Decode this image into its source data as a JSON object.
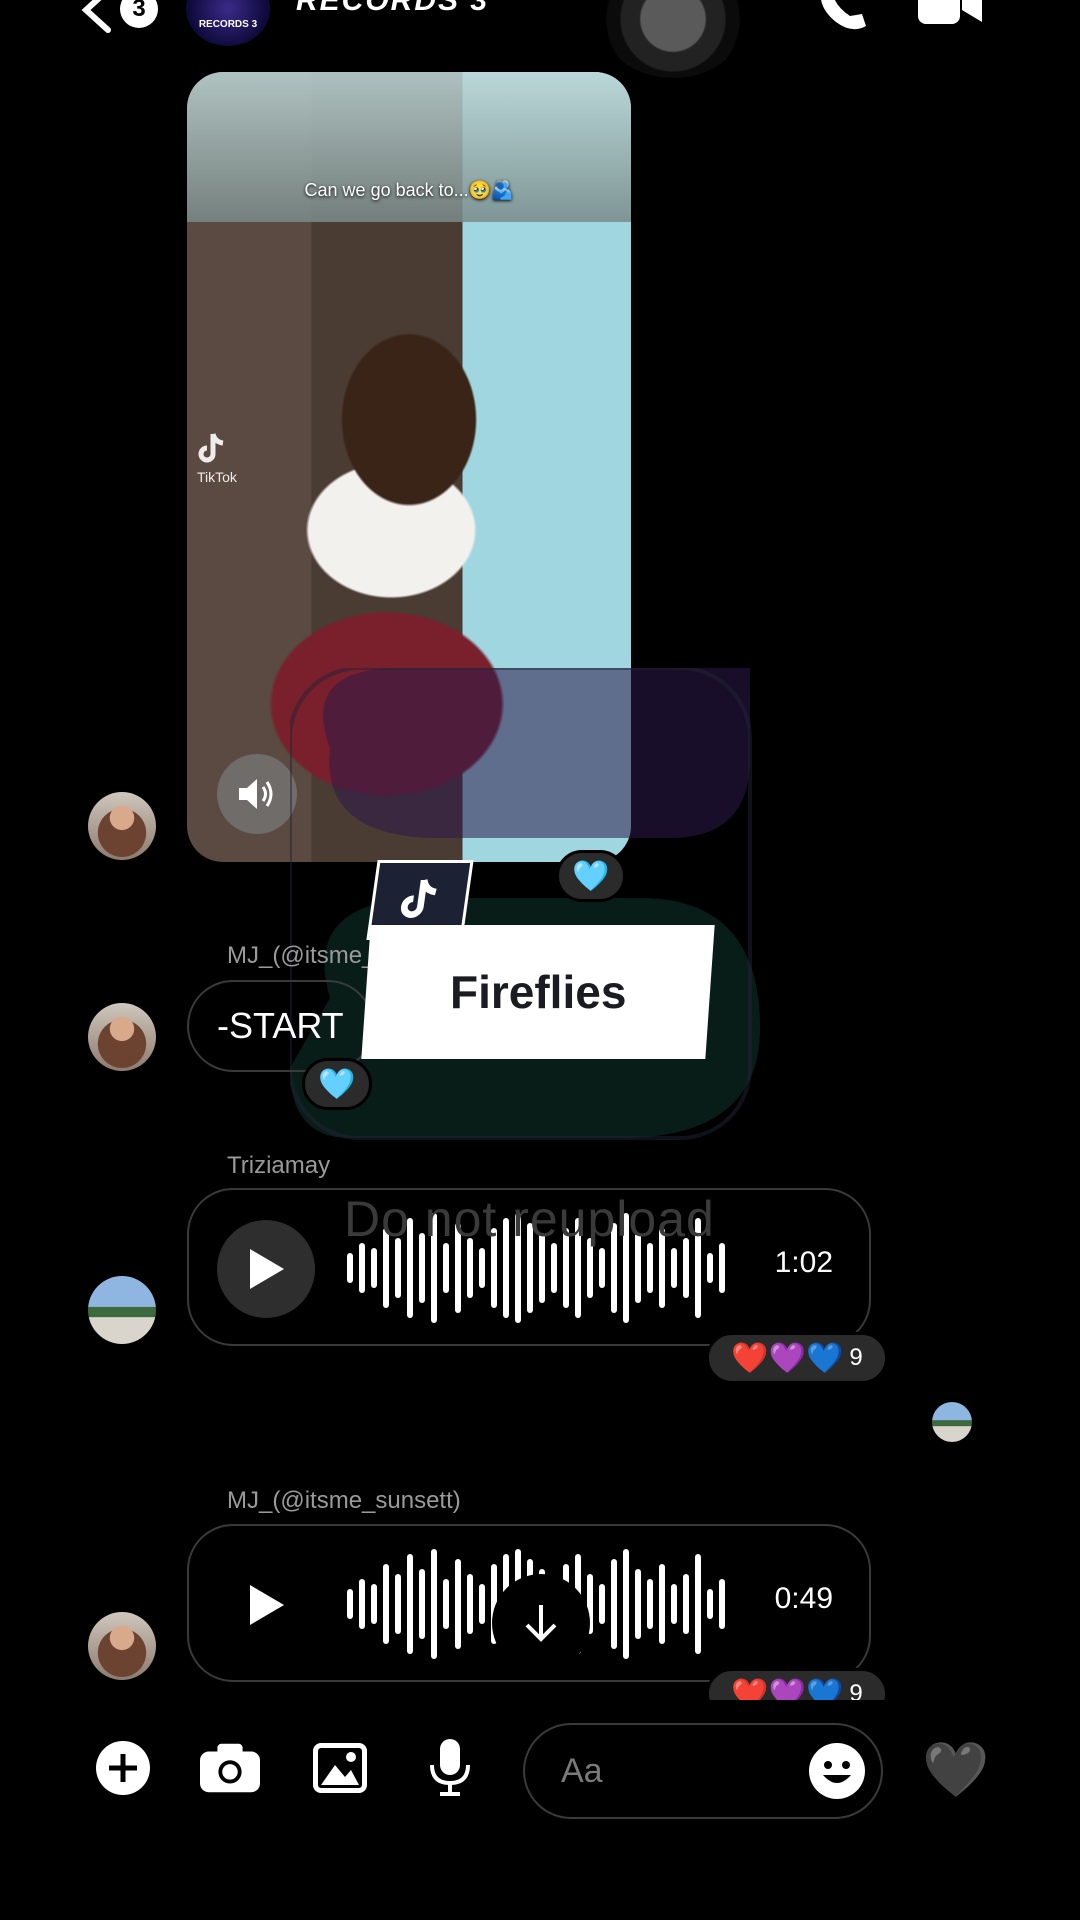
{
  "header": {
    "back_count": "3",
    "group_avatar_text": "RECORDS 3",
    "title": "RECORDS 3"
  },
  "video": {
    "caption": "Can we go back to...🥹🫂",
    "tiktok_mark": "TikTok",
    "reaction": "🩵"
  },
  "overlay": {
    "song_title": "Fireflies",
    "watermark": "Do not reupload"
  },
  "messages": [
    {
      "sender": "MJ_(@itsme_",
      "text": "-START",
      "reaction": "🩵"
    },
    {
      "sender": "Triziamay",
      "duration": "1:02",
      "reactions": "❤️💜💙",
      "reaction_count": "9"
    },
    {
      "sender": "MJ_(@itsme_sunsett)",
      "duration": "0:49",
      "reactions": "❤️💜💙",
      "reaction_count": "9"
    }
  ],
  "composer": {
    "placeholder": "Aa",
    "like_emoji": "🖤"
  },
  "colors": {
    "background": "#000000",
    "bubble_border": "#3a3a3a",
    "pill_bg": "#2b2b2b",
    "muted_text": "#9a9a9a"
  }
}
